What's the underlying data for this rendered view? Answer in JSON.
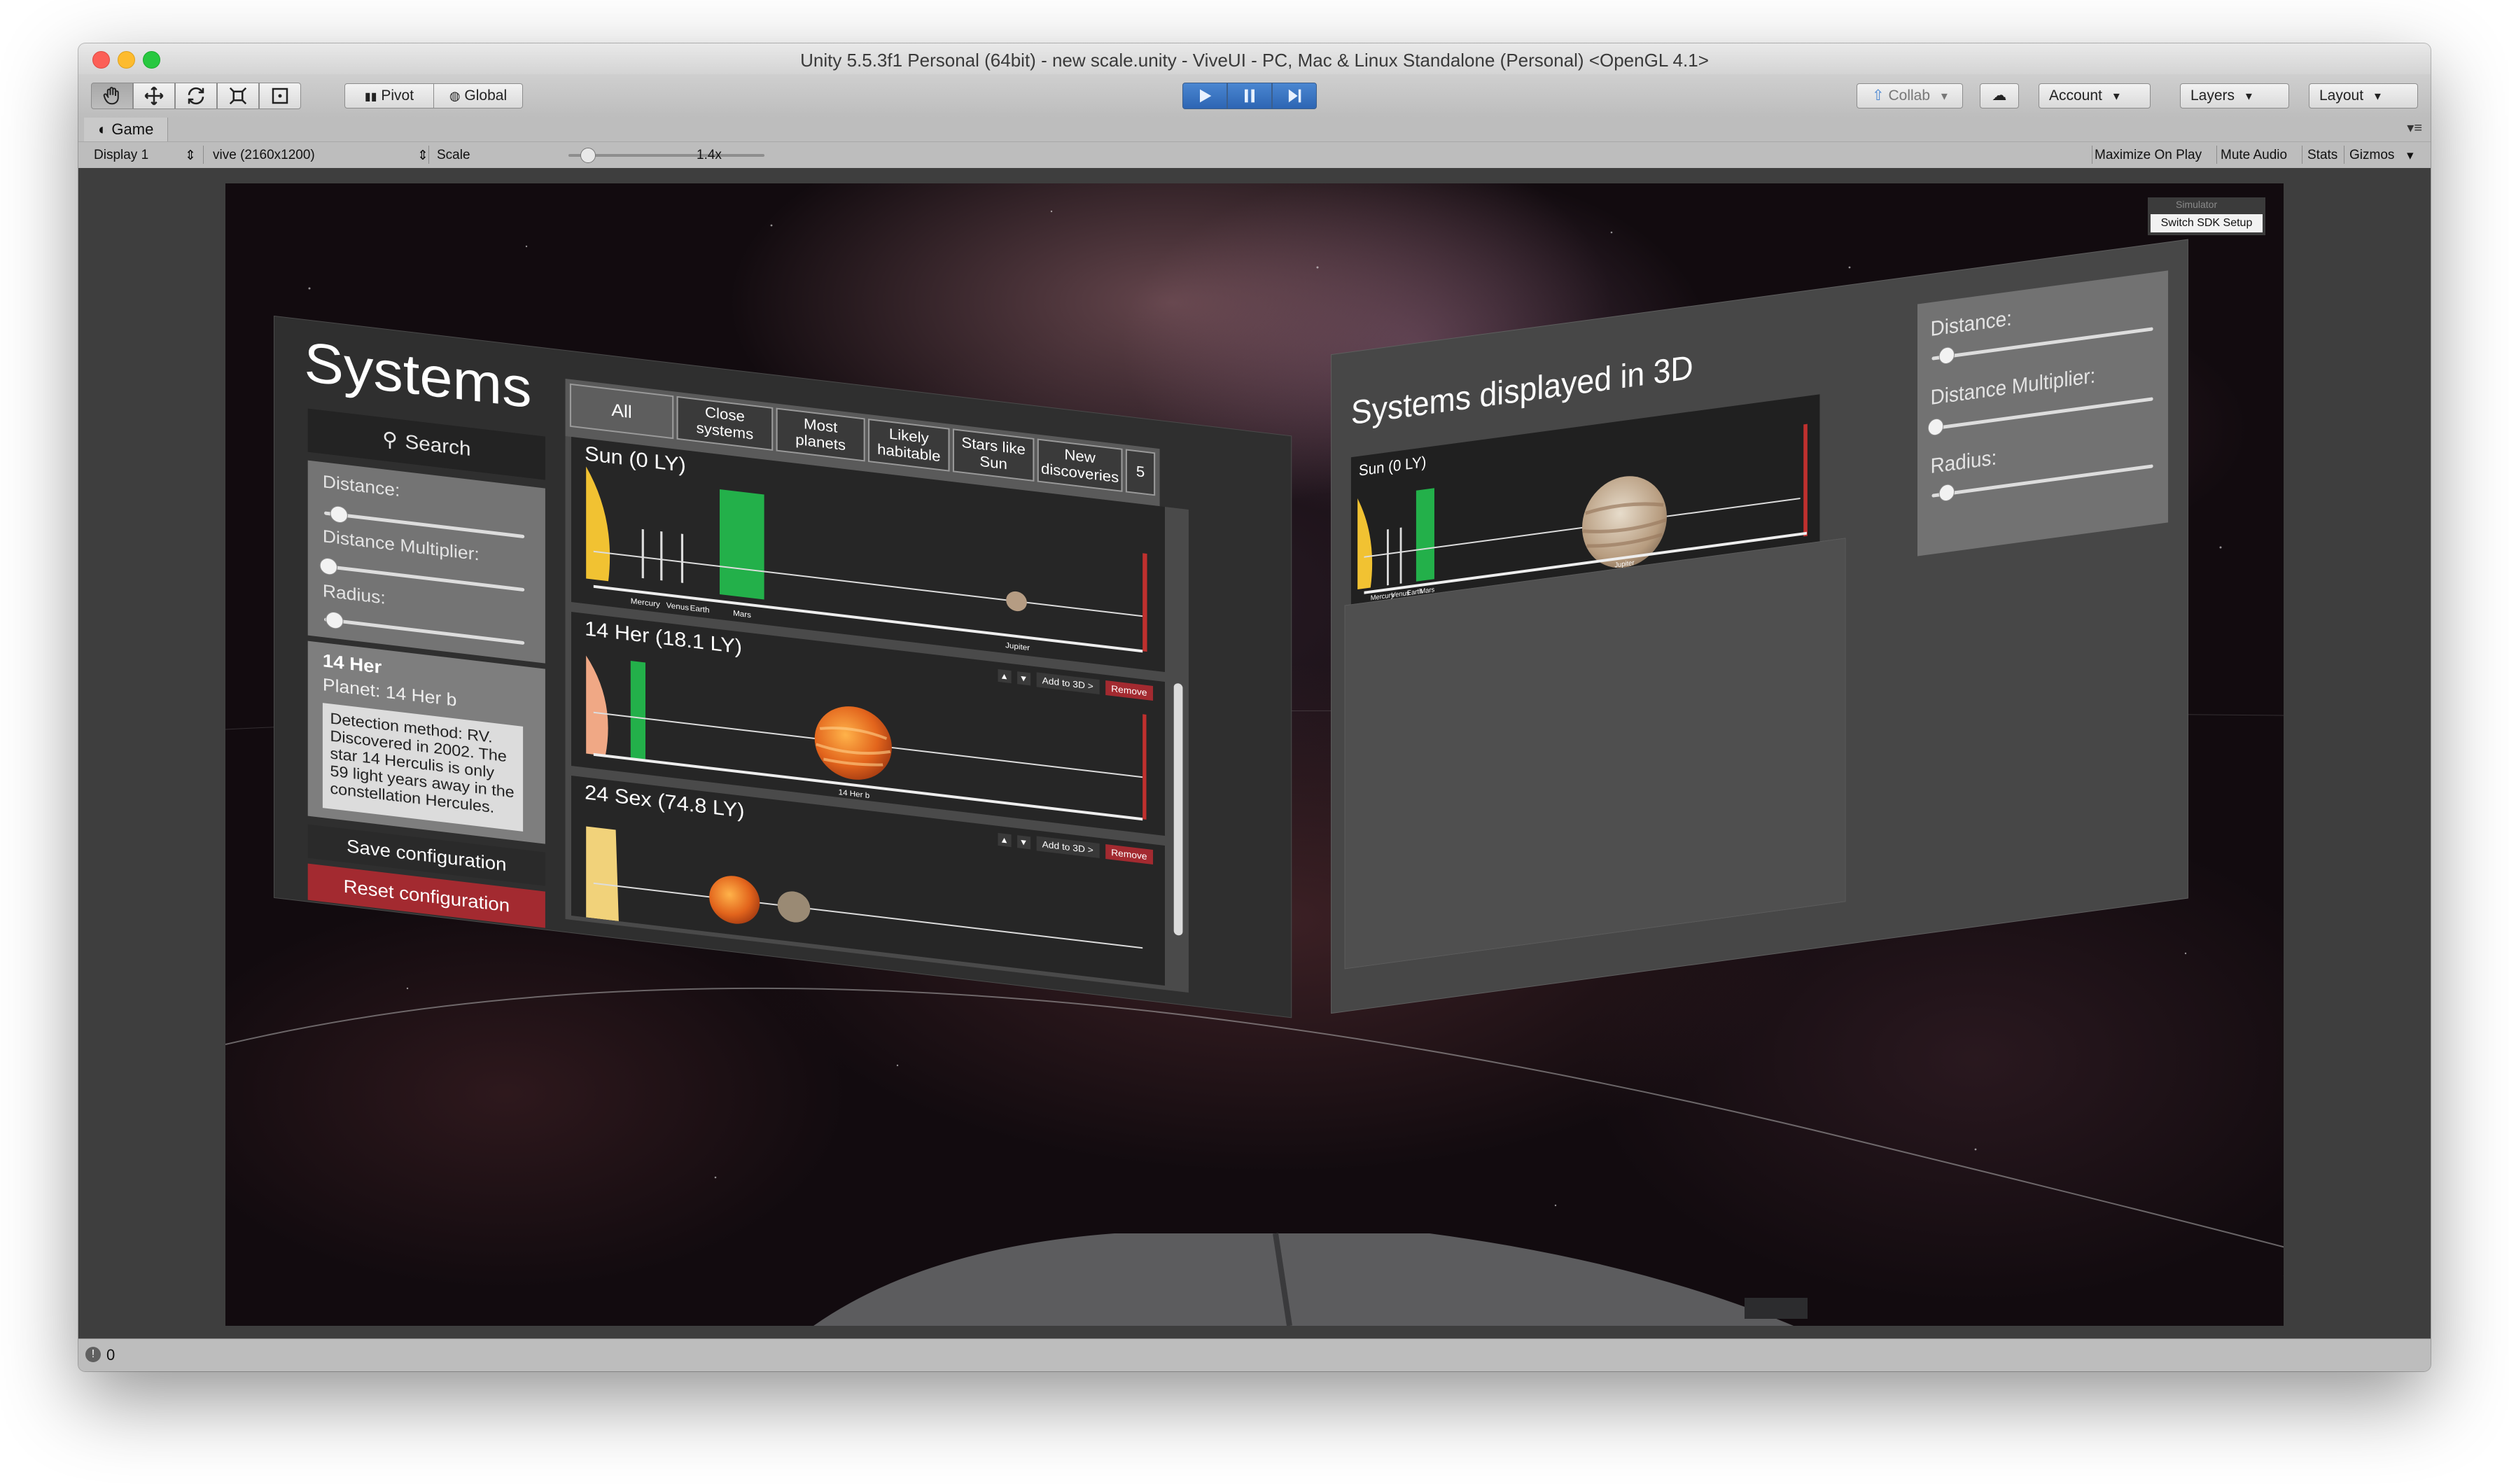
{
  "window": {
    "title": "Unity 5.5.3f1 Personal (64bit) - new scale.unity - ViveUI - PC, Mac & Linux Standalone (Personal) <OpenGL 4.1>"
  },
  "toolbar": {
    "pivot": "Pivot",
    "global": "Global",
    "collab": "Collab",
    "account": "Account",
    "layers": "Layers",
    "layout": "Layout"
  },
  "game_view": {
    "tab": "Game",
    "display": "Display 1",
    "resolution": "vive (2160x1200)",
    "scale_label": "Scale",
    "scale_value": "1.4x",
    "scale_fraction": 0.04,
    "maximize": "Maximize On Play",
    "mute": "Mute Audio",
    "stats": "Stats",
    "gizmos": "Gizmos"
  },
  "left_panel": {
    "title": "Systems",
    "search": "Search",
    "sliders": [
      {
        "label": "Distance:",
        "value": 0.05
      },
      {
        "label": "Distance Multiplier:",
        "value": 0.0
      },
      {
        "label": "Radius:",
        "value": 0.03
      }
    ],
    "selected": {
      "system": "14 Her",
      "planet": "Planet: 14 Her b",
      "description": "Detection method: RV. Discovered in 2002. The star 14 Herculis is only 59 light years away in the constellation Hercules."
    },
    "save": "Save configuration",
    "reset": "Reset configuration",
    "tabs": [
      "All",
      "Close systems",
      "Most planets",
      "Likely habitable",
      "Stars like Sun",
      "New discoveries",
      "5"
    ],
    "cards": [
      {
        "name": "Sun (0 LY)",
        "labels": [
          "Mercury",
          "Venus",
          "Earth",
          "Mars",
          "Jupiter"
        ]
      },
      {
        "name": "14 Her (18.1 LY)",
        "labels": [
          "14 Her b"
        ],
        "add": "Add to 3D >",
        "remove": "Remove"
      },
      {
        "name": "24 Sex (74.8 LY)",
        "labels": [],
        "add": "Add to 3D >",
        "remove": "Remove"
      }
    ]
  },
  "right_panel": {
    "title": "Systems displayed in 3D",
    "system": "Sun (0 LY)",
    "labels": [
      "Mercury",
      "Venus",
      "Earth",
      "Mars",
      "Jupiter"
    ],
    "sliders": [
      {
        "label": "Distance:",
        "value": 0.05
      },
      {
        "label": "Distance Multiplier:",
        "value": 0.0
      },
      {
        "label": "Radius:",
        "value": 0.05
      }
    ]
  },
  "sdk": {
    "dim_label": "Simulator",
    "button": "Switch SDK Setup"
  },
  "status": {
    "count": "0"
  },
  "colors": {
    "play_blue": "#2d65b3",
    "remove_red": "#a32a30",
    "habitable_green": "#23b04a",
    "sun_yellow": "#f1c232"
  }
}
